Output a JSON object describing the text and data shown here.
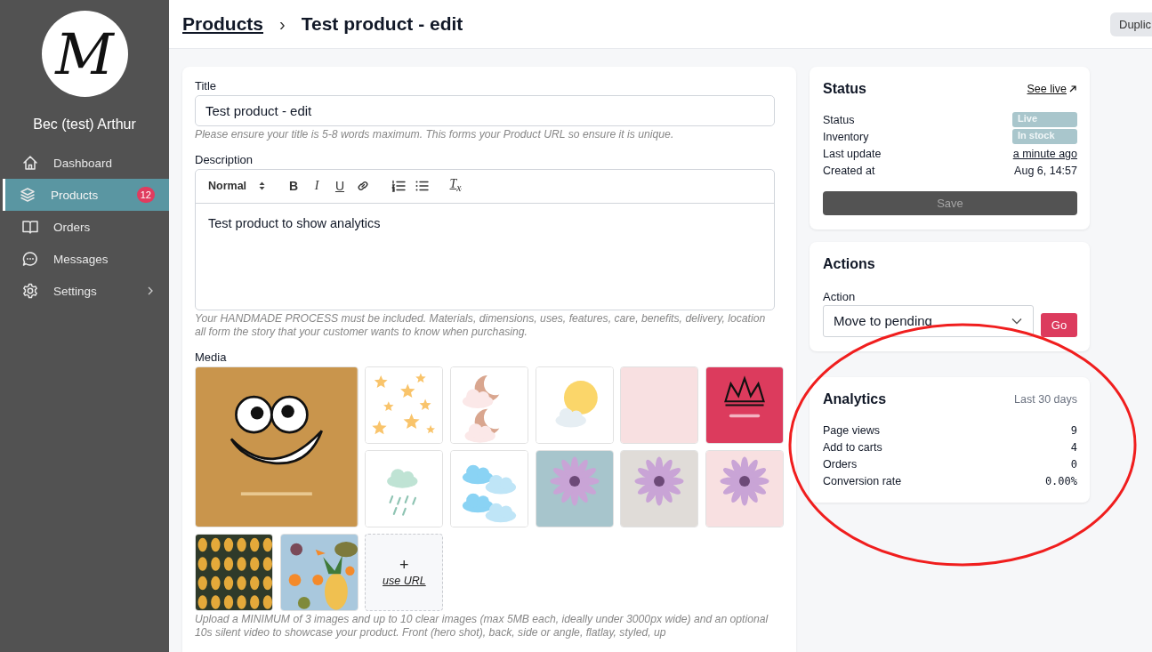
{
  "sidebar": {
    "avatar_letter": "M",
    "user_name": "Bec (test) Arthur",
    "items": [
      {
        "kind": "home",
        "label": "Dashboard",
        "selected": false
      },
      {
        "kind": "layers",
        "label": "Products",
        "selected": true,
        "badge": "12"
      },
      {
        "kind": "book",
        "label": "Orders",
        "selected": false
      },
      {
        "kind": "chat",
        "label": "Messages",
        "selected": false
      },
      {
        "kind": "gear",
        "label": "Settings",
        "selected": false,
        "has_submenu": true
      }
    ]
  },
  "header": {
    "breadcrumb_link": "Products",
    "separator": "›",
    "title": "Test product - edit",
    "button": "Duplic"
  },
  "form": {
    "title_label": "Title",
    "title_value": "Test product - edit",
    "title_help": "Please ensure your title is 5-8 words maximum. This forms your Product URL so ensure it is unique.",
    "description_label": "Description",
    "toolbar": {
      "format": "Normal",
      "tools": [
        {
          "kind": "bold",
          "glyph": "B"
        },
        {
          "kind": "italic",
          "glyph": "I"
        },
        {
          "kind": "underline",
          "glyph": "U"
        },
        {
          "kind": "link"
        },
        {
          "kind": "ordered-list"
        },
        {
          "kind": "bullet-list"
        },
        {
          "kind": "clean",
          "glyph": "T$_{x}$"
        }
      ]
    },
    "description_value": "Test product to show analytics",
    "description_help": "Your HANDMADE PROCESS must be included. Materials, dimensions, uses, features, care, benefits, delivery, location all form the story that your customer wants to know when purchasing.",
    "media_label": "Media",
    "add_url": {
      "icon": "+",
      "label": "use URL"
    },
    "media_help": "Upload a MINIMUM of 3 images and up to 10 clear images (max 5MB each, ideally under 3000px wide) and an optional 10s silent video to showcase your product. Front (hero shot), back, side or angle, flatlay, styled, up"
  },
  "status": {
    "heading": "Status",
    "link": "See live",
    "rows": [
      {
        "label": "Status",
        "value": "Live",
        "kind": "badge"
      },
      {
        "label": "Inventory",
        "value": "In stock",
        "kind": "badge"
      },
      {
        "label": "Last update",
        "value": "a minute ago",
        "kind": "link"
      },
      {
        "label": "Created at",
        "value": "Aug 6, 14:57",
        "kind": "text"
      }
    ],
    "save": {
      "label": "Save",
      "disabled": true
    }
  },
  "actions": {
    "heading": "Actions",
    "label": "Action",
    "value": "Move to pending",
    "button": "Go"
  },
  "analytics": {
    "heading": "Analytics",
    "period": "Last 30 days",
    "rows": [
      {
        "label": "Page views",
        "value": "9"
      },
      {
        "label": "Add to carts",
        "value": "4"
      },
      {
        "label": "Orders",
        "value": "0"
      },
      {
        "label": "Conversion rate",
        "value": "0.00%"
      }
    ]
  },
  "annotation": {
    "kind": "ellipse"
  }
}
